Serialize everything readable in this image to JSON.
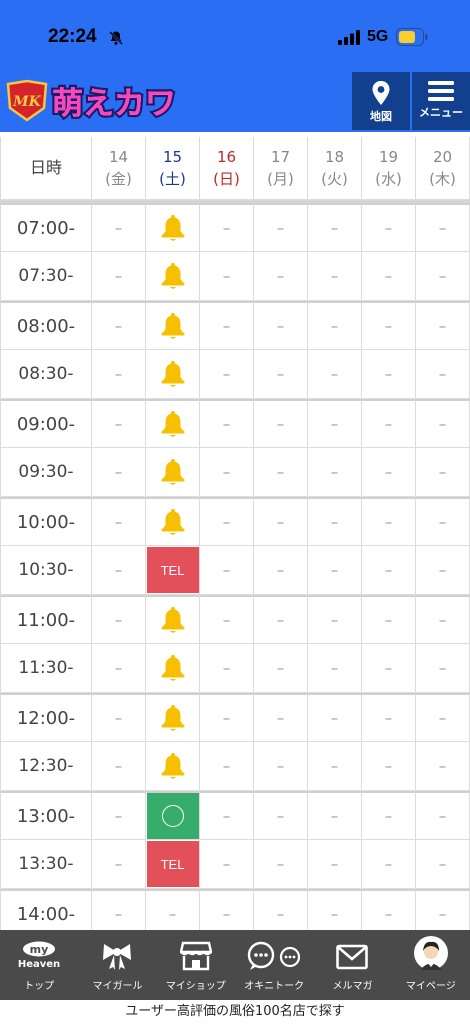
{
  "status_bar": {
    "time": "22:24",
    "network": "5G"
  },
  "header": {
    "logo_text": "萌えカワ",
    "logo_badge": "MK",
    "map_label": "地図",
    "menu_label": "メニュー"
  },
  "colors": {
    "header_blue": "#2a6ef4",
    "header_button": "#12408f",
    "tel_red": "#e4505a",
    "ok_green": "#37ad6b",
    "bell_yellow": "#f6c000",
    "nav_dark": "#4a4a4a"
  },
  "schedule": {
    "header_label": "日時",
    "days": [
      {
        "date": "14",
        "weekday": "(金)",
        "type": "weekday"
      },
      {
        "date": "15",
        "weekday": "(土)",
        "type": "sat"
      },
      {
        "date": "16",
        "weekday": "(日)",
        "type": "sun"
      },
      {
        "date": "17",
        "weekday": "(月)",
        "type": "weekday"
      },
      {
        "date": "18",
        "weekday": "(火)",
        "type": "weekday"
      },
      {
        "date": "19",
        "weekday": "(水)",
        "type": "weekday"
      },
      {
        "date": "20",
        "weekday": "(木)",
        "type": "weekday"
      }
    ],
    "rows": [
      {
        "time": "07:00-",
        "cells": [
          "–",
          "bell",
          "–",
          "–",
          "–",
          "–",
          "–"
        ]
      },
      {
        "time": "07:30-",
        "cells": [
          "–",
          "bell",
          "–",
          "–",
          "–",
          "–",
          "–"
        ]
      },
      {
        "time": "08:00-",
        "cells": [
          "–",
          "bell",
          "–",
          "–",
          "–",
          "–",
          "–"
        ]
      },
      {
        "time": "08:30-",
        "cells": [
          "–",
          "bell",
          "–",
          "–",
          "–",
          "–",
          "–"
        ]
      },
      {
        "time": "09:00-",
        "cells": [
          "–",
          "bell",
          "–",
          "–",
          "–",
          "–",
          "–"
        ]
      },
      {
        "time": "09:30-",
        "cells": [
          "–",
          "bell",
          "–",
          "–",
          "–",
          "–",
          "–"
        ]
      },
      {
        "time": "10:00-",
        "cells": [
          "–",
          "bell",
          "–",
          "–",
          "–",
          "–",
          "–"
        ]
      },
      {
        "time": "10:30-",
        "cells": [
          "–",
          "TEL",
          "–",
          "–",
          "–",
          "–",
          "–"
        ]
      },
      {
        "time": "11:00-",
        "cells": [
          "–",
          "bell",
          "–",
          "–",
          "–",
          "–",
          "–"
        ]
      },
      {
        "time": "11:30-",
        "cells": [
          "–",
          "bell",
          "–",
          "–",
          "–",
          "–",
          "–"
        ]
      },
      {
        "time": "12:00-",
        "cells": [
          "–",
          "bell",
          "–",
          "–",
          "–",
          "–",
          "–"
        ]
      },
      {
        "time": "12:30-",
        "cells": [
          "–",
          "bell",
          "–",
          "–",
          "–",
          "–",
          "–"
        ]
      },
      {
        "time": "13:00-",
        "cells": [
          "–",
          "ok",
          "–",
          "–",
          "–",
          "–",
          "–"
        ]
      },
      {
        "time": "13:30-",
        "cells": [
          "–",
          "TEL",
          "–",
          "–",
          "–",
          "–",
          "–"
        ]
      },
      {
        "time": "14:00-",
        "cells": [
          "–",
          "–",
          "–",
          "–",
          "–",
          "–",
          "–"
        ]
      }
    ]
  },
  "bottom_nav": {
    "items": [
      {
        "label": "トップ",
        "icon": "my-heaven-icon",
        "icon_text": "my",
        "icon_sub": "Heaven"
      },
      {
        "label": "マイガール",
        "icon": "ribbon-icon"
      },
      {
        "label": "マイショップ",
        "icon": "shop-icon"
      },
      {
        "label": "オキニトーク",
        "icon": "chat-icon"
      },
      {
        "label": "メルマガ",
        "icon": "mail-icon"
      },
      {
        "label": "マイページ",
        "icon": "avatar-icon"
      }
    ]
  },
  "footer_text": "ユーザー高評価の風俗100名店で探す"
}
